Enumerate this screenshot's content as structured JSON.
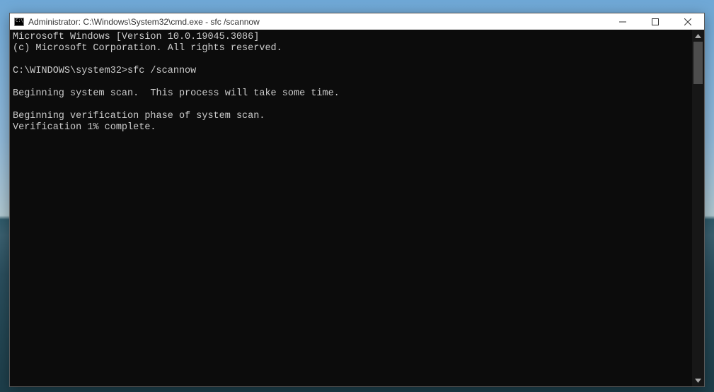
{
  "window": {
    "title": "Administrator: C:\\Windows\\System32\\cmd.exe - sfc  /scannow"
  },
  "terminal": {
    "lines": [
      "Microsoft Windows [Version 10.0.19045.3086]",
      "(c) Microsoft Corporation. All rights reserved.",
      "",
      "C:\\WINDOWS\\system32>sfc /scannow",
      "",
      "Beginning system scan.  This process will take some time.",
      "",
      "Beginning verification phase of system scan.",
      "Verification 1% complete."
    ]
  }
}
